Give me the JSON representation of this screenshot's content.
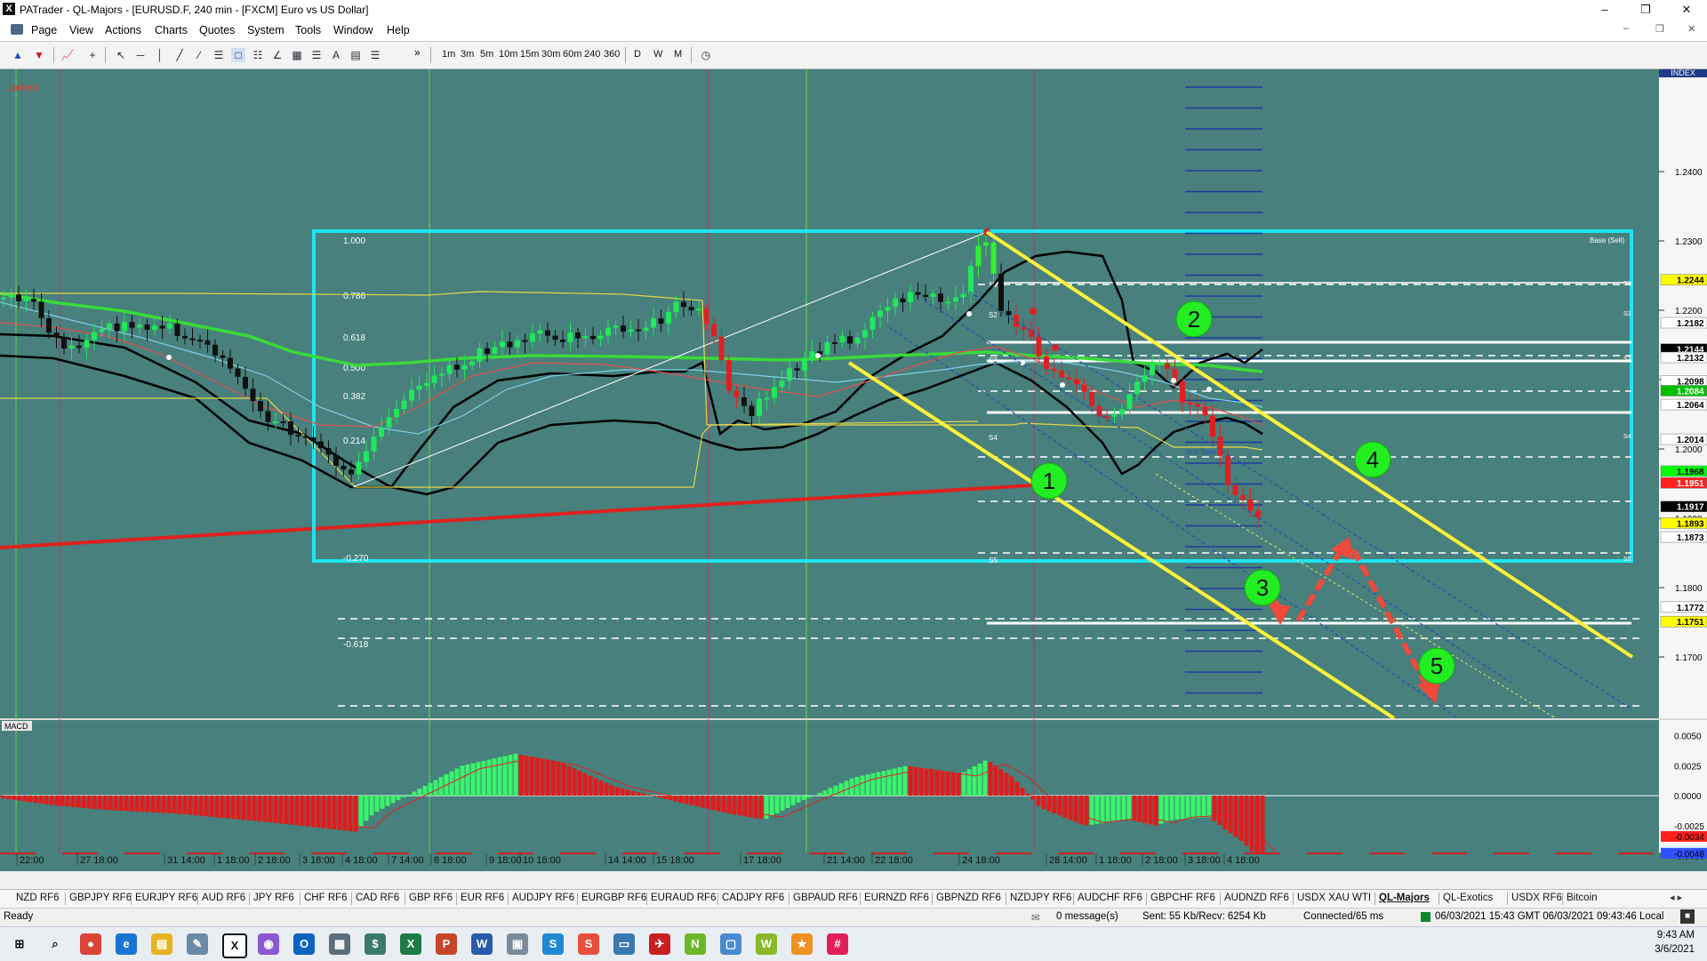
{
  "window": {
    "title": "PATrader - QL-Majors - [EURUSD.F, 240 min - [FXCM] Euro vs US Dollar]"
  },
  "menu": [
    "Page",
    "View",
    "Actions",
    "Charts",
    "Quotes",
    "System",
    "Tools",
    "Window",
    "Help"
  ],
  "toolbar": {
    "timeframes": [
      "1m",
      "3m",
      "5m",
      "10m",
      "15m",
      "30m",
      "60m",
      "240",
      "360",
      "D",
      "W",
      "M"
    ],
    "overflow": "»"
  },
  "chart": {
    "locked_label": "Locked",
    "index_label": "INDEX",
    "macd_label": "MACD",
    "price_axis": [
      "1.2400",
      "1.2300",
      "1.2200",
      "1.2100",
      "1.2000",
      "1.1900",
      "1.1800",
      "1.1700"
    ],
    "macd_axis": [
      "0.0050",
      "0.0025",
      "0.0000",
      "-0.0025",
      "-0.0050"
    ],
    "fib_levels": [
      "1.000",
      "0.786",
      "0.618",
      "0.500",
      "0.382",
      "0.214",
      "-0.270",
      "-0.618"
    ],
    "price_tags": [
      {
        "label": "1.2244",
        "bg": "#ffff00",
        "fg": "#000"
      },
      {
        "label": "1.2182",
        "bg": "#ffffff",
        "fg": "#000"
      },
      {
        "label": "1.2144",
        "bg": "#000000",
        "fg": "#fff"
      },
      {
        "label": "1.2132",
        "bg": "#ffffff",
        "fg": "#000"
      },
      {
        "label": "1.2098",
        "bg": "#ffffff",
        "fg": "#000"
      },
      {
        "label": "1.2084",
        "bg": "#00c000",
        "fg": "#fff"
      },
      {
        "label": "1.2064",
        "bg": "#ffffff",
        "fg": "#000"
      },
      {
        "label": "1.2014",
        "bg": "#ffffff",
        "fg": "#000"
      },
      {
        "label": "1.1968",
        "bg": "#00ff00",
        "fg": "#000"
      },
      {
        "label": "1.1951",
        "bg": "#ff2020",
        "fg": "#fff"
      },
      {
        "label": "1.1917",
        "bg": "#000000",
        "fg": "#fff"
      },
      {
        "label": "1.1893",
        "bg": "#ffff00",
        "fg": "#000"
      },
      {
        "label": "1.1873",
        "bg": "#ffffff",
        "fg": "#000"
      },
      {
        "label": "1.1772",
        "bg": "#ffffff",
        "fg": "#000"
      },
      {
        "label": "1.1751",
        "bg": "#ffff00",
        "fg": "#000"
      }
    ],
    "macd_tags": [
      {
        "label": "-0.0034",
        "bg": "#ff2020",
        "fg": "#000"
      },
      {
        "label": "-0.0048",
        "bg": "#3050ff",
        "fg": "#000"
      }
    ],
    "pivots": [
      "S1",
      "S2",
      "S3",
      "S4",
      "S5"
    ],
    "level_labels": [
      "Base (Sell)",
      "Grid Base"
    ],
    "wave_labels": [
      "1",
      "2",
      "3",
      "4",
      "5"
    ],
    "time_axis": [
      "22:00",
      "27 18:00",
      "31 14:00",
      "1 18:00",
      "2 18:00",
      "3 18:00",
      "4 18:00",
      "7 14:00",
      "8 18:00",
      "9 18:00",
      "10 18:00",
      "14 14:00",
      "15 18:00",
      "17 18:00",
      "21 14:00",
      "22 18:00",
      "24 18:00",
      "28 14:00",
      "1 18:00",
      "2 18:00",
      "3 18:00",
      "4 18:00"
    ]
  },
  "symbol_tabs": [
    "NZD RF6",
    "GBPJPY RF6",
    "EURJPY RF6",
    "AUD RF6",
    "JPY RF6",
    "CHF RF6",
    "CAD RF6",
    "GBP RF6",
    "EUR RF6",
    "AUDJPY RF6",
    "EURGBP RF6",
    "EURAUD RF6",
    "CADJPY RF6",
    "GBPAUD RF6",
    "EURNZD RF6",
    "GBPNZD RF6",
    "NZDJPY RF6",
    "AUDCHF RF6",
    "GBPCHF RF6",
    "AUDNZD RF6",
    "USDX XAU WTI",
    "QL-Majors",
    "QL-Exotics",
    "USDX RF6",
    "Bitcoin"
  ],
  "active_tab": "QL-Majors",
  "status": {
    "ready": "Ready",
    "messages": "0 message(s)",
    "traffic": "Sent: 55 Kb/Recv: 6254 Kb",
    "connection": "Connected/65 ms",
    "times": "06/03/2021 15:43 GMT  06/03/2021 09:43:46 Local"
  },
  "taskbar": {
    "icons": [
      "windows-start",
      "search",
      "chrome",
      "edge",
      "file-explorer",
      "pen-app",
      "patrader",
      "podcast",
      "outlook",
      "calculator",
      "money-app",
      "excel",
      "powerpoint",
      "word",
      "folder",
      "s-app",
      "s-app-2",
      "monitor-app",
      "bird-app",
      "n-app",
      "display-app",
      "w-app",
      "spark-app",
      "slack"
    ],
    "time": "9:43 AM",
    "date": "3/6/2021"
  }
}
